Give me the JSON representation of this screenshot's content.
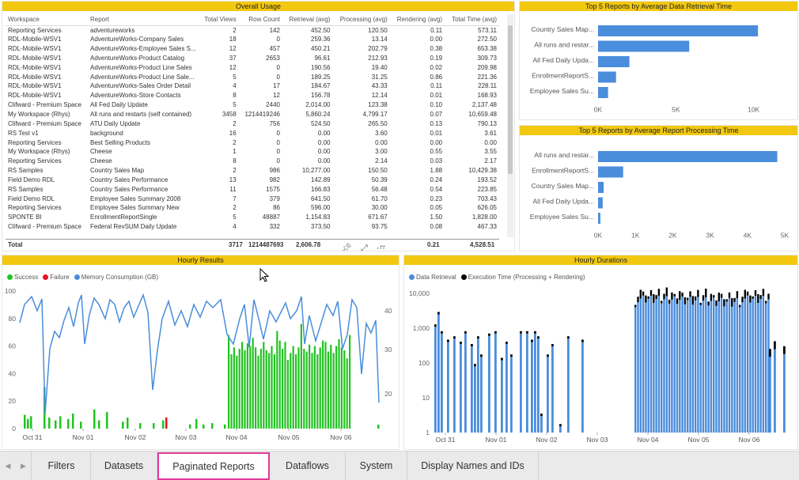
{
  "usage": {
    "title": "Overall Usage",
    "columns": [
      "Workspace",
      "Report",
      "Total Views",
      "Row Count",
      "Retrieval (avg)",
      "Processing (avg)",
      "Rendering (avg)",
      "Total Time (avg)"
    ],
    "rows": [
      [
        "Reporting Services",
        "adventureworks",
        "2",
        "142",
        "452.50",
        "120.50",
        "0.11",
        "573.11"
      ],
      [
        "RDL-Mobile-WSV1",
        "AdventureWorks-Company Sales",
        "18",
        "0",
        "259.36",
        "13.14",
        "0.00",
        "272.50"
      ],
      [
        "RDL-Mobile-WSV1",
        "AdventureWorks-Employee Sales S...",
        "12",
        "457",
        "450.21",
        "202.79",
        "0.38",
        "653.38"
      ],
      [
        "RDL-Mobile-WSV1",
        "AdventureWorks-Product Catalog",
        "37",
        "2653",
        "96.61",
        "212.93",
        "0.19",
        "309.73"
      ],
      [
        "RDL-Mobile-WSV1",
        "AdventureWorks-Product Line Sales",
        "12",
        "0",
        "190.56",
        "19.40",
        "0.02",
        "209.98"
      ],
      [
        "RDL-Mobile-WSV1",
        "AdventureWorks-Product Line Sale...",
        "5",
        "0",
        "189.25",
        "31.25",
        "0.86",
        "221.36"
      ],
      [
        "RDL-Mobile-WSV1",
        "AdventureWorks-Sales Order Detail",
        "4",
        "17",
        "184.67",
        "43.33",
        "0.11",
        "228.11"
      ],
      [
        "RDL-Mobile-WSV1",
        "AdventureWorks-Store Contacts",
        "8",
        "12",
        "156.78",
        "12.14",
        "0.01",
        "168.93"
      ],
      [
        "Clifward - Premium Space",
        "All Fed Daily Update",
        "5",
        "2440",
        "2,014.00",
        "123.38",
        "0.10",
        "2,137.48"
      ],
      [
        "My Workspace (Rhys)",
        "All runs and restarts (self contained)",
        "3458",
        "1214419246",
        "5,860.24",
        "4,799.17",
        "0.07",
        "10,659.48"
      ],
      [
        "Clifward - Premium Space",
        "ATU Daily Update",
        "2",
        "756",
        "524.50",
        "265.50",
        "0.13",
        "790.13"
      ],
      [
        "RS Test v1",
        "background",
        "16",
        "0",
        "0.00",
        "3.60",
        "0.01",
        "3.61"
      ],
      [
        "Reporting Services",
        "Best Selling Products",
        "2",
        "0",
        "0.00",
        "0.00",
        "0.00",
        "0.00"
      ],
      [
        "My Workspace (Rhys)",
        "Cheese",
        "1",
        "0",
        "0.00",
        "3.00",
        "0.55",
        "3.55"
      ],
      [
        "Reporting Services",
        "Cheese",
        "8",
        "0",
        "0.00",
        "2.14",
        "0.03",
        "2.17"
      ],
      [
        "RS Samples",
        "Country Sales Map",
        "2",
        "986",
        "10,277.00",
        "150.50",
        "1.88",
        "10,429.38"
      ],
      [
        "Field Demo RDL",
        "Country Sales Performance",
        "13",
        "982",
        "142.89",
        "50.39",
        "0.24",
        "193.52"
      ],
      [
        "RS Samples",
        "Country Sales Performance",
        "11",
        "1575",
        "166.83",
        "56.48",
        "0.54",
        "223.85"
      ],
      [
        "Field Demo RDL",
        "Employee Sales Summary 2008",
        "7",
        "379",
        "641.50",
        "61.70",
        "0.23",
        "703.43"
      ],
      [
        "Reporting Services",
        "Employee Sales Summary New",
        "2",
        "86",
        "596.00",
        "30.00",
        "0.05",
        "626.05"
      ],
      [
        "SPONTE BI",
        "EnrollmentReportSingle",
        "5",
        "48887",
        "1,154.83",
        "671.67",
        "1.50",
        "1,828.00"
      ],
      [
        "Clifward - Premium Space",
        "Federal RevSUM Daily Update",
        "4",
        "332",
        "373.50",
        "93.75",
        "0.08",
        "467.33"
      ]
    ],
    "total": {
      "label": "Total",
      "views": "3717",
      "rows": "1214487693",
      "retrieval": "2,606.78",
      "processing": "...",
      "rendering": "0.21",
      "total_time": "4,528.51"
    }
  },
  "retrieval_chart": {
    "title": "Top 5 Reports by Average Data Retrieval Time",
    "categories": [
      "Country Sales Map...",
      "All runs and restar...",
      "All Fed Daily Upda...",
      "EnrollmentReportS...",
      "Employee Sales Su..."
    ],
    "values": [
      10277,
      5860.24,
      2014,
      1154.83,
      641.5
    ],
    "xmax": 12000,
    "ticks": [
      {
        "v": 0,
        "l": "0K"
      },
      {
        "v": 5000,
        "l": "5K"
      },
      {
        "v": 10000,
        "l": "10K"
      }
    ],
    "color": "#4a8ddc"
  },
  "processing_chart": {
    "title": "Top 5 Reports by Average Report Processing Time",
    "categories": [
      "All runs and restar...",
      "EnrollmentReportS...",
      "Country Sales Map...",
      "All Fed Daily Upda...",
      "Employee Sales Su..."
    ],
    "values": [
      4799.17,
      671.67,
      150.5,
      123.38,
      61.7
    ],
    "xmax": 5000,
    "ticks": [
      {
        "v": 0,
        "l": "0K"
      },
      {
        "v": 1000,
        "l": "1K"
      },
      {
        "v": 2000,
        "l": "2K"
      },
      {
        "v": 3000,
        "l": "3K"
      },
      {
        "v": 4000,
        "l": "4K"
      },
      {
        "v": 5000,
        "l": "5K"
      }
    ],
    "color": "#4a8ddc"
  },
  "hourly_results": {
    "title": "Hourly Results",
    "legend": [
      {
        "name": "Success",
        "color": "#21c321"
      },
      {
        "name": "Failure",
        "color": "#e81123"
      },
      {
        "name": "Memory Consumption (GB)",
        "color": "#4a8ddc"
      }
    ],
    "left_ticks": [
      "0",
      "20",
      "40",
      "60",
      "80",
      "100"
    ],
    "right_ticks": [
      "20",
      "30",
      "40"
    ],
    "x_labels": [
      "Oct 31",
      "Nov 01",
      "Nov 02",
      "Nov 03",
      "Nov 04",
      "Nov 05",
      "Nov 06"
    ]
  },
  "hourly_durations": {
    "title": "Hourly Durations",
    "legend": [
      {
        "name": "Data Retrieval",
        "color": "#4a8ddc"
      },
      {
        "name": "Execution Time (Processing + Rendering)",
        "color": "#000000"
      }
    ],
    "y_ticks": [
      "1",
      "10",
      "100",
      "1,000",
      "10,000"
    ],
    "x_labels": [
      "Oct 31",
      "Nov 01",
      "Nov 02",
      "Nov 03",
      "Nov 04",
      "Nov 05",
      "Nov 06"
    ]
  },
  "tabs": {
    "items": [
      "Filters",
      "Datasets",
      "Paginated Reports",
      "Dataflows",
      "System",
      "Display Names and IDs"
    ],
    "active": "Paginated Reports"
  }
}
